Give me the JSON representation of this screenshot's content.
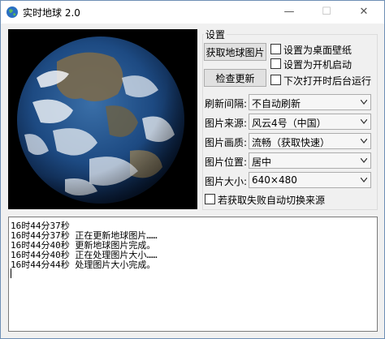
{
  "window": {
    "title": "实时地球 2.0",
    "controls": {
      "minimize": "—",
      "maximize": "☐",
      "close": "✕"
    }
  },
  "settings": {
    "group_title": "设置",
    "buttons": {
      "fetch": "获取地球图片",
      "update": "检查更新"
    },
    "checkboxes": [
      {
        "label": "设置为桌面壁纸",
        "checked": false
      },
      {
        "label": "设置为开机启动",
        "checked": false
      },
      {
        "label": "下次打开时后台运行",
        "checked": false
      }
    ],
    "fields": [
      {
        "label": "刷新间隔:",
        "value": "不自动刷新"
      },
      {
        "label": "图片来源:",
        "value": "风云4号（中国）"
      },
      {
        "label": "图片画质:",
        "value": "流畅（获取快速）"
      },
      {
        "label": "图片位置:",
        "value": "居中"
      },
      {
        "label": "图片大小:",
        "value": "640×480"
      }
    ],
    "fallback_checkbox": {
      "label": "若获取失败自动切换来源",
      "checked": false
    }
  },
  "log": {
    "lines": [
      "16时44分37秒",
      "16时44分37秒  正在更新地球图片……",
      "16时44分40秒  更新地球图片完成。",
      "16时44分40秒  正在处理图片大小……",
      "16时44分44秒  处理图片大小完成。"
    ]
  },
  "colors": {
    "accent_border": "#0078d7",
    "earth_ocean": "#163a6b"
  }
}
